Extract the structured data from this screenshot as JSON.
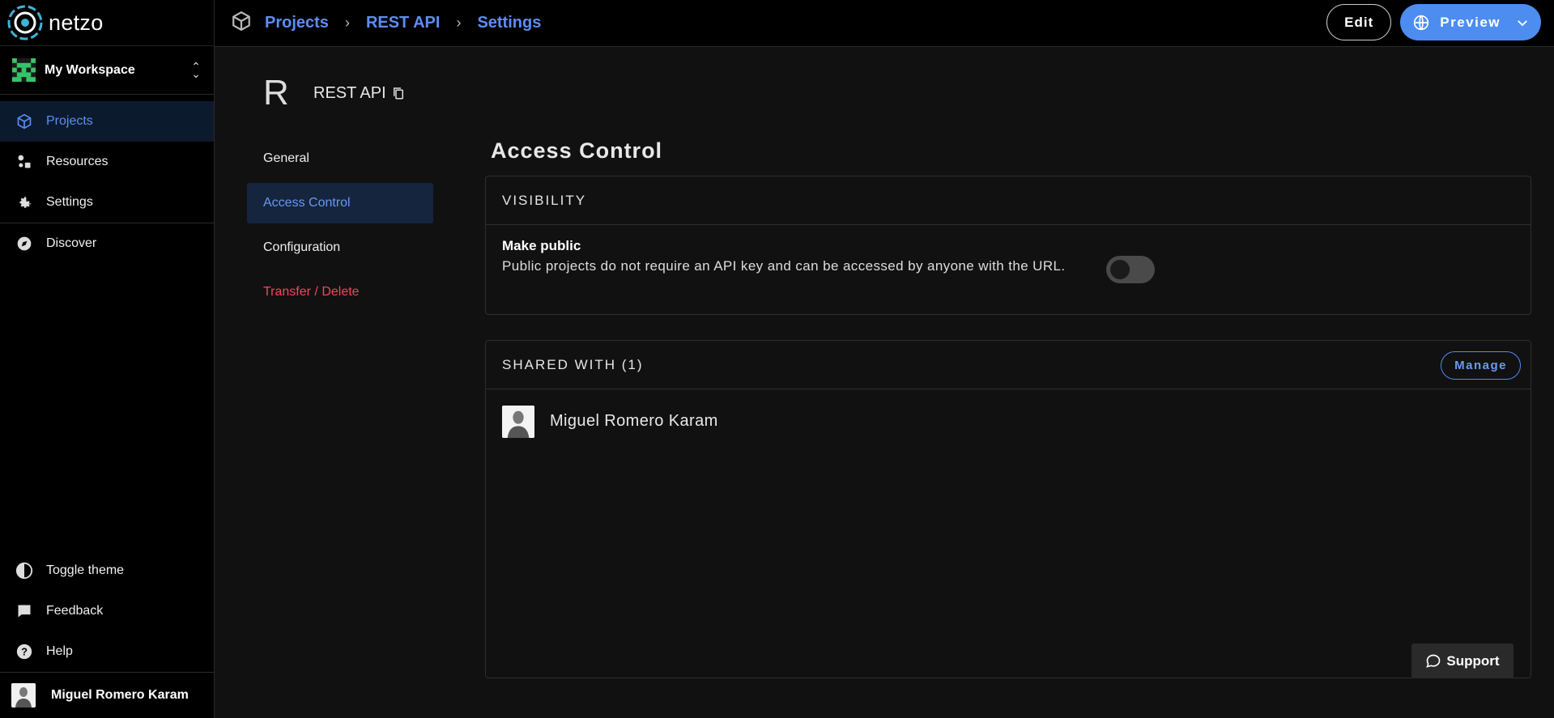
{
  "app": {
    "logo_text": "netzo"
  },
  "workspace": {
    "name": "My Workspace"
  },
  "sidebar": {
    "items": [
      {
        "label": "Projects",
        "icon": "cube-icon",
        "active": true
      },
      {
        "label": "Resources",
        "icon": "resources-icon"
      },
      {
        "label": "Settings",
        "icon": "gear-icon"
      },
      {
        "label": "Discover",
        "icon": "compass-icon"
      }
    ],
    "bottom_items": [
      {
        "label": "Toggle theme",
        "icon": "contrast-icon"
      },
      {
        "label": "Feedback",
        "icon": "chat-icon"
      },
      {
        "label": "Help",
        "icon": "help-icon"
      }
    ],
    "user": {
      "name": "Miguel Romero Karam"
    }
  },
  "breadcrumb": [
    "Projects",
    "REST API",
    "Settings"
  ],
  "top_actions": {
    "edit_label": "Edit",
    "preview_label": "Preview"
  },
  "project": {
    "letter": "R",
    "name": "REST API"
  },
  "settings_nav": [
    {
      "label": "General"
    },
    {
      "label": "Access Control",
      "active": true
    },
    {
      "label": "Configuration"
    },
    {
      "label": "Transfer / Delete",
      "danger": true
    }
  ],
  "section_title": "Access Control",
  "visibility": {
    "heading": "VISIBILITY",
    "title": "Make public",
    "description": "Public projects do not require an API key and can be accessed by anyone with the URL.",
    "enabled": false
  },
  "shared": {
    "heading": "SHARED WITH (1)",
    "manage_label": "Manage",
    "users": [
      {
        "name": "Miguel Romero Karam"
      }
    ]
  },
  "support_label": "Support",
  "colors": {
    "accent": "#4d8df0",
    "danger": "#f0485a",
    "background": "#111112"
  }
}
